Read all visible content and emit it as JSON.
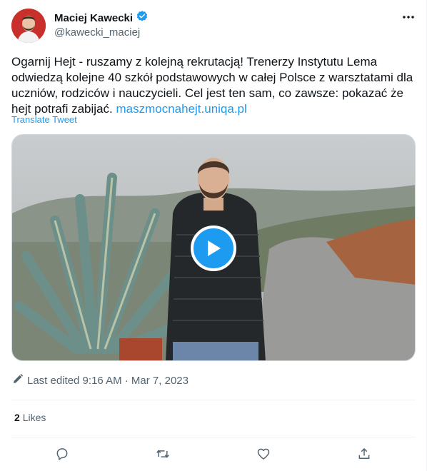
{
  "author": {
    "name": "Maciej Kawecki",
    "handle": "@kawecki_maciej",
    "verified_color": "#1d9bf0",
    "avatar_bg": "#c8302b"
  },
  "tweet": {
    "text": "Ogarnij Hejt - ruszamy z kolejną rekrutacją! Trenerzy Instytutu Lema odwiedzą kolejne 40 szkół podstawowych w całej Polsce z warsztatami dla uczniów, rodziców i nauczycieli. Cel jest ten sam, co zawsze: pokazać że hejt potrafi zabijać. ",
    "link": "maszmocnahejt.uniqa.pl",
    "translate_label": "Translate Tweet"
  },
  "media": {
    "type": "video",
    "play_icon": "play-icon"
  },
  "meta": {
    "edited_label": "Last edited 9:16 AM · Mar 7, 2023"
  },
  "stats": {
    "likes_count": "2",
    "likes_label": "Likes"
  },
  "actions": [
    "reply-icon",
    "retweet-icon",
    "like-icon",
    "share-icon"
  ],
  "colors": {
    "accent": "#1d9bf0",
    "text": "#0f1419",
    "muted": "#536471",
    "divider": "#eff3f4"
  }
}
